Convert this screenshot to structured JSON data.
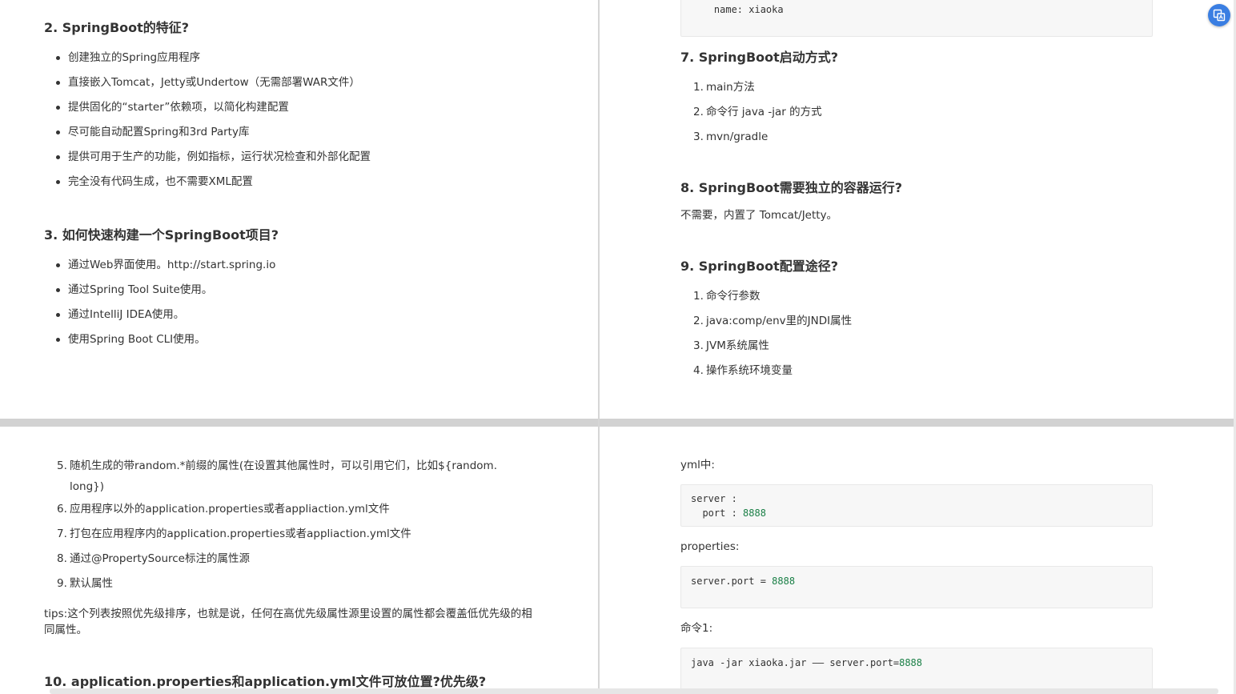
{
  "page1": {
    "heading2": "2. SpringBoot的特征?",
    "features": [
      "创建独立的Spring应用程序",
      "直接嵌入Tomcat，Jetty或Undertow（无需部署WAR文件）",
      "提供固化的“starter”依赖项，以简化构建配置",
      "尽可能自动配置Spring和3rd Party库",
      "提供可用于生产的功能，例如指标，运行状况检查和外部化配置",
      "完全没有代码生成，也不需要XML配置"
    ],
    "heading3": "3. 如何快速构建一个SpringBoot项目?",
    "build_ways": [
      "通过Web界面使用。http://start.spring.io",
      "通过Spring Tool Suite使用。",
      "通过IntelliJ IDEA使用。",
      "使用Spring Boot CLI使用。"
    ]
  },
  "page2": {
    "code_top": "    name: xiaoka",
    "heading7": "7. SpringBoot启动方式?",
    "start_ways": [
      {
        "n": "1.",
        "text": "main方法"
      },
      {
        "n": "2.",
        "text": "命令行 java -jar 的方式"
      },
      {
        "n": "3.",
        "text": "mvn/gradle"
      }
    ],
    "heading8": "8. SpringBoot需要独立的容器运行?",
    "answer8": "不需要，内置了 Tomcat/Jetty。",
    "heading9": "9. SpringBoot配置途径?",
    "config_ways": [
      {
        "n": "1.",
        "text": "命令行参数"
      },
      {
        "n": "2.",
        "text": "java:comp/env里的JNDI属性"
      },
      {
        "n": "3.",
        "text": "JVM系统属性"
      },
      {
        "n": "4.",
        "text": "操作系统环境变量"
      }
    ]
  },
  "page3": {
    "item5_n": "5.",
    "item5_line1": "随机生成的带random.*前缀的属性(在设置其他属性时，可以引用它们，比如${random.",
    "item5_line2": "long})",
    "items": [
      {
        "n": "6.",
        "text": "应用程序以外的application.properties或者appliaction.yml文件"
      },
      {
        "n": "7.",
        "text": "打包在应用程序内的application.properties或者appliaction.yml文件"
      },
      {
        "n": "8.",
        "text": "通过@PropertySource标注的属性源"
      },
      {
        "n": "9.",
        "text": "默认属性"
      }
    ],
    "tips_line1": "tips:这个列表按照优先级排序，也就是说，任何在高优先级属性源里设置的属性都会覆盖低优先级的相",
    "tips_line2": "同属性。",
    "heading10": "10. application.properties和application.yml文件可放位置?优先级?"
  },
  "page4": {
    "label_yml": "yml中:",
    "yml_line1": "server :",
    "yml_line2_key": "  port : ",
    "yml_line2_val": "8888",
    "label_properties": "properties:",
    "prop_key": "server.port = ",
    "prop_val": "8888",
    "label_cmd": "命令1:",
    "cmd_text": "java -jar xiaoka.jar —— server.port=",
    "cmd_val": "8888"
  },
  "colors": {
    "code_number": "#1a7f46",
    "fab": "#3a7ee2"
  },
  "fab_icon": "translate-icon"
}
